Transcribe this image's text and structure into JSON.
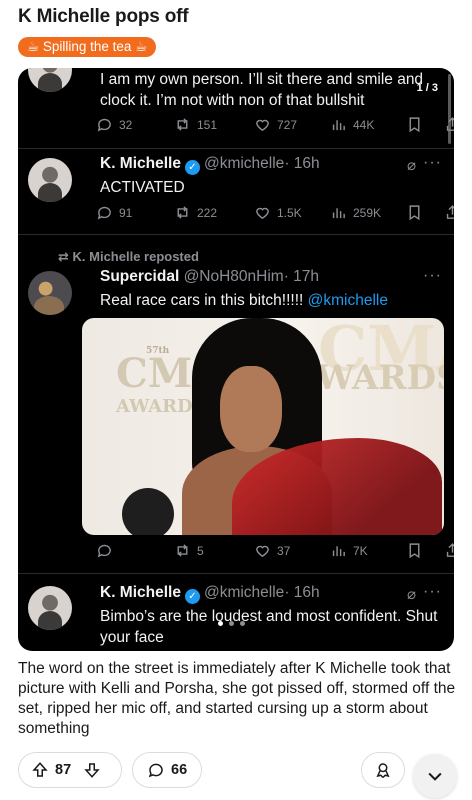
{
  "post": {
    "title": "K Michelle pops off",
    "flair": "☕ Spilling the tea ☕",
    "body": "The word on the street is immediately after K Michelle took that picture with Kelli and Porsha, she got pissed off, stormed off the set, ripped her mic off, and started cursing up a storm about something"
  },
  "gallery": {
    "counter": "1 / 3",
    "tweets": [
      {
        "text": "I am my own person. I’ll sit there and smile and\nclock it. I’m not with non of that bullshit",
        "replies": "32",
        "reposts": "151",
        "likes": "727",
        "views": "44K"
      },
      {
        "name": "K. Michelle",
        "handle": "@kmichelle",
        "time": "· 16h",
        "text": "ACTIVATED",
        "replies": "91",
        "reposts": "222",
        "likes": "1.5K",
        "views": "259K"
      },
      {
        "repost_label": "K. Michelle reposted",
        "name": "Supercidal",
        "handle": "@NoH80nHim",
        "time": "· 17h",
        "text": "Real race cars in this bitch!!!!! ",
        "mention": "@kmichelle",
        "photo_words": [
          "CMA",
          "57th",
          "AWARDS",
          "CMA",
          "WARDS"
        ],
        "replies": "",
        "reposts": "5",
        "likes": "37",
        "views": "7K"
      },
      {
        "name": "K. Michelle",
        "handle": "@kmichelle",
        "time": "· 16h",
        "text": "Bimbo’s are the loudest and most confident. Shut\nyour face"
      }
    ]
  },
  "actions": {
    "upvotes": "87",
    "comments": "66"
  },
  "colors": {
    "flair": "#f26c1d",
    "link": "#1d9bf0",
    "verified": "#1d9bf0"
  },
  "icons": [
    "reply-icon",
    "repost-icon",
    "like-icon",
    "views-icon",
    "bookmark-icon",
    "share-icon",
    "verified-icon",
    "grok-icon",
    "more-icon",
    "upvote-icon",
    "downvote-icon",
    "comment-icon",
    "award-icon",
    "chevron-down-icon"
  ]
}
